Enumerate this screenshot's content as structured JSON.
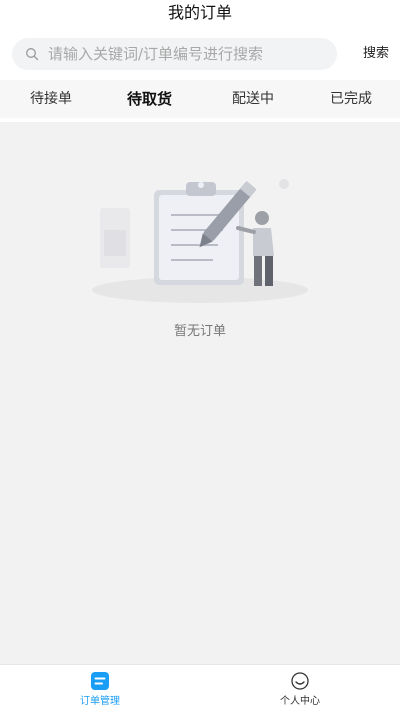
{
  "header": {
    "title": "我的订单"
  },
  "search": {
    "placeholder": "请输入关键词/订单编号进行搜索",
    "button_label": "搜索"
  },
  "tabs": [
    {
      "label": "待接单",
      "active": false
    },
    {
      "label": "待取货",
      "active": true
    },
    {
      "label": "配送中",
      "active": false
    },
    {
      "label": "已完成",
      "active": false
    }
  ],
  "empty_state": {
    "message": "暂无订单",
    "illustration": "clipboard-with-pencil-and-person"
  },
  "bottom_nav": [
    {
      "label": "订单管理",
      "icon": "order-list-icon",
      "active": true
    },
    {
      "label": "个人中心",
      "icon": "profile-smile-icon",
      "active": false
    }
  ],
  "colors": {
    "accent": "#1a9ef5",
    "background": "#f2f2f2"
  }
}
